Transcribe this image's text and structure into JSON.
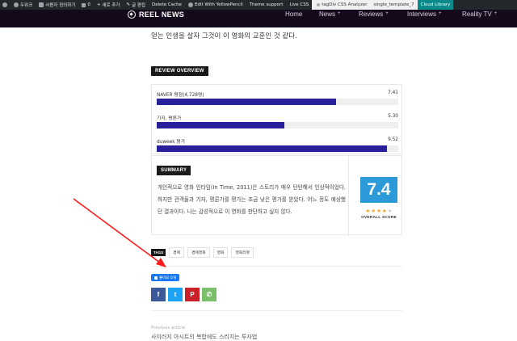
{
  "admin_bar": {
    "site_name": "두위크",
    "customize": "사용자 정의하기",
    "comments_count": "0",
    "new_label": "새로 추가",
    "edit_post": "글 편집",
    "delete_cache": "Delete Cache",
    "yellow_pencil": "Edit With YellowPencil",
    "theme_support": "Theme support",
    "live_css": "Live CSS",
    "tagdiv_analyzer": "tagDiv CSS Analyzer",
    "template": "single_template_7",
    "cloud_library": "Cloud Library"
  },
  "header": {
    "logo_text": "REEL NEWS",
    "nav": [
      {
        "label": "Home",
        "plus": ""
      },
      {
        "label": "News",
        "plus": "+"
      },
      {
        "label": "Reviews",
        "plus": "+"
      },
      {
        "label": "Interviews",
        "plus": "+"
      },
      {
        "label": "Reality TV",
        "plus": "+"
      }
    ]
  },
  "article": {
    "intro_text": "얻는 인생을 살자 그것이 이 영화의 교훈인 것 같다."
  },
  "review": {
    "overview_title": "REVIEW OVERVIEW",
    "scores": [
      {
        "label": "NAVER 평점(4,728명)",
        "value_text": "7.41",
        "value": 7.41
      },
      {
        "label": "기자, 평론가",
        "value_text": "5.30",
        "value": 5.3
      },
      {
        "label": "duweek 평가",
        "value_text": "9.52",
        "value": 9.52
      }
    ],
    "max_score": 10,
    "summary_title": "SUMMARY",
    "summary_text": "개인적으로 영화 인타임(In Time, 2011)은 스토리가 매우 탄탄해서 인상적이었다. 하지만 관객들과 기자, 평론가를 평가는 조금 낮은 평가를 받았다. 어느 정도 예상했던 결과이다. 나는 감성적으로 이 영화를 판단하고 싶지 않다.",
    "overall_score": "7.4",
    "stars": 3.5,
    "overall_label": "OVERALL SCORE"
  },
  "tags": {
    "label": "TAGS",
    "items": [
      "경제",
      "경제영화",
      "영화",
      "영화리뷰"
    ]
  },
  "social": {
    "like_label": "좋아요 0개",
    "share_buttons": [
      {
        "name": "facebook",
        "glyph": "f",
        "color": "#3b5998"
      },
      {
        "name": "twitter",
        "glyph": "t",
        "color": "#1da1f2"
      },
      {
        "name": "pinterest",
        "glyph": "P",
        "color": "#cb2027"
      },
      {
        "name": "whatsapp",
        "glyph": "✆",
        "color": "#7bbf6a"
      }
    ]
  },
  "navigation": {
    "previous_label": "Previous article",
    "previous_title": "사이러지 아시트의 복합에도 스리치는 투자법"
  }
}
